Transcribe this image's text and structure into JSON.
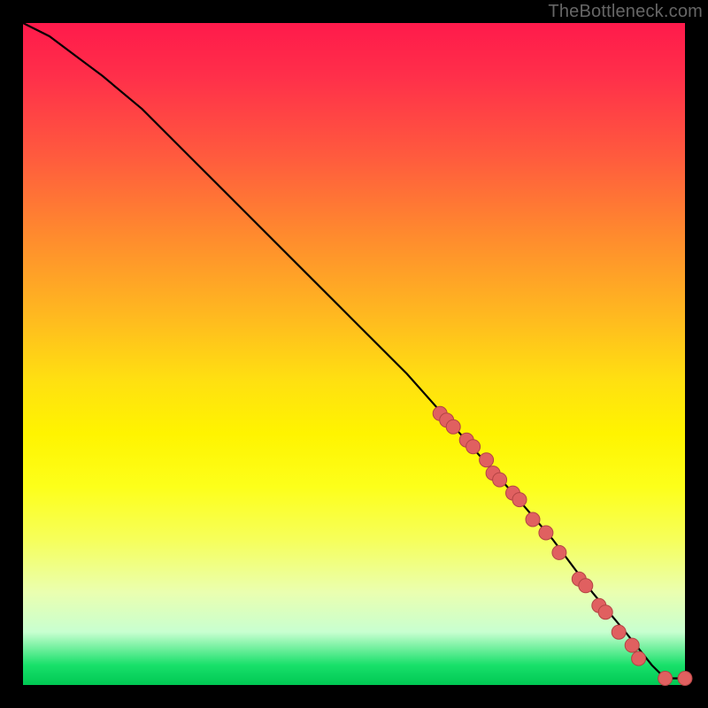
{
  "attribution": "TheBottleneck.com",
  "colors": {
    "background": "#000000",
    "gradient_top": "#ff1a4b",
    "gradient_bottom": "#00c853",
    "curve": "#000000",
    "point_fill": "#e06060",
    "point_stroke": "#b34444"
  },
  "chart_data": {
    "type": "line",
    "title": "",
    "xlabel": "",
    "ylabel": "",
    "xlim": [
      0,
      100
    ],
    "ylim": [
      0,
      100
    ],
    "curve": {
      "x": [
        0,
        4,
        8,
        12,
        18,
        25,
        33,
        42,
        50,
        58,
        66,
        74,
        80,
        86,
        91,
        95,
        97,
        100
      ],
      "y": [
        100,
        98,
        95,
        92,
        87,
        80,
        72,
        63,
        55,
        47,
        38,
        29,
        22,
        14,
        8,
        3,
        1,
        1
      ]
    },
    "series": [
      {
        "name": "points",
        "values": [
          {
            "x": 63,
            "y": 41
          },
          {
            "x": 64,
            "y": 40
          },
          {
            "x": 65,
            "y": 39
          },
          {
            "x": 67,
            "y": 37
          },
          {
            "x": 68,
            "y": 36
          },
          {
            "x": 70,
            "y": 34
          },
          {
            "x": 71,
            "y": 32
          },
          {
            "x": 72,
            "y": 31
          },
          {
            "x": 74,
            "y": 29
          },
          {
            "x": 75,
            "y": 28
          },
          {
            "x": 77,
            "y": 25
          },
          {
            "x": 79,
            "y": 23
          },
          {
            "x": 81,
            "y": 20
          },
          {
            "x": 84,
            "y": 16
          },
          {
            "x": 85,
            "y": 15
          },
          {
            "x": 87,
            "y": 12
          },
          {
            "x": 88,
            "y": 11
          },
          {
            "x": 90,
            "y": 8
          },
          {
            "x": 92,
            "y": 6
          },
          {
            "x": 93,
            "y": 4
          },
          {
            "x": 97,
            "y": 1
          },
          {
            "x": 100,
            "y": 1
          }
        ]
      }
    ]
  }
}
